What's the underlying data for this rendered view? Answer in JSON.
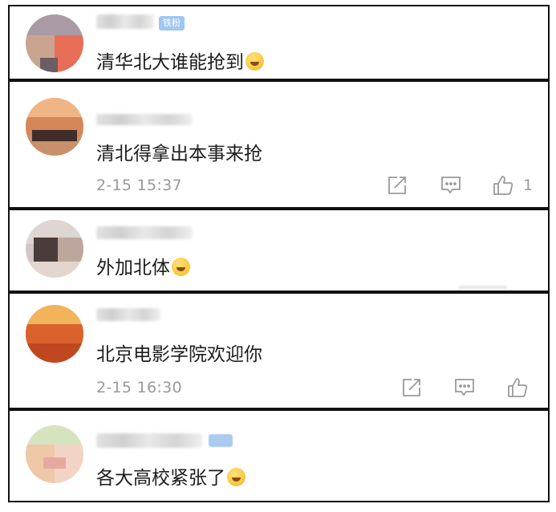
{
  "comments": [
    {
      "id": 1,
      "text": "清华北大谁能抢到",
      "badge": "铁粉"
    },
    {
      "id": 2,
      "text": "清北得拿出本事来抢",
      "time": "2-15 15:37",
      "likes": "1"
    },
    {
      "id": 3,
      "text": "外加北体"
    },
    {
      "id": 4,
      "text": "北京电影学院欢迎你",
      "time": "2-15 16:30"
    },
    {
      "id": 5,
      "text": "各大高校紧张了"
    }
  ],
  "icons": {
    "share": "share-icon",
    "reply": "reply-icon",
    "like": "thumbs-up-icon",
    "emoji": "emoji-icon"
  },
  "colors": {
    "badge": "#9ec7f2",
    "meta_text": "#999999",
    "border": "#111111"
  }
}
